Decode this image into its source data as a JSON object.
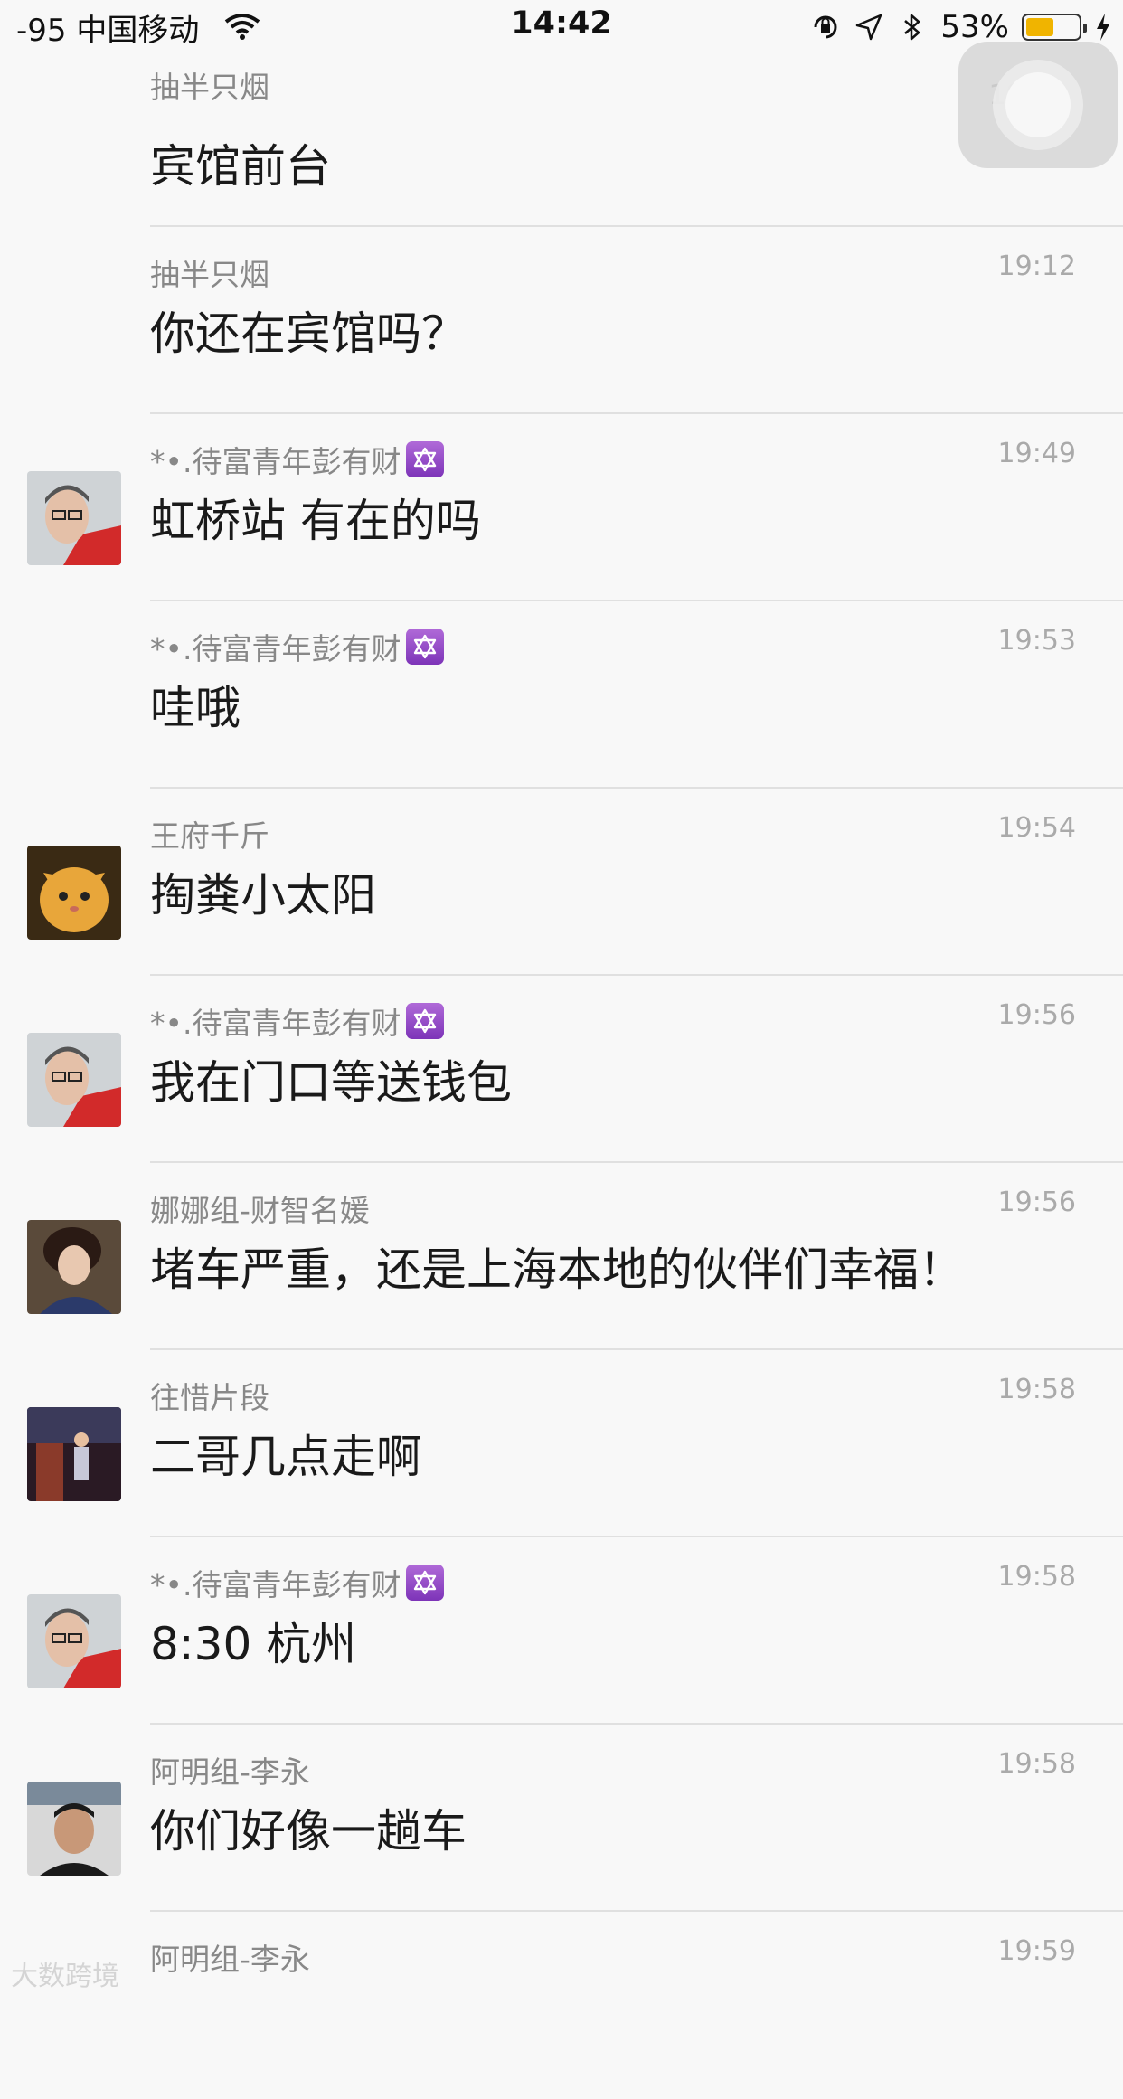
{
  "status_bar": {
    "signal": "-95 中国移动",
    "time": "14:42",
    "battery_percent": "53%",
    "battery_level": 0.53,
    "battery_color": "#f0b400",
    "icons": [
      "wifi-icon",
      "orientation-lock-icon",
      "location-arrow-icon",
      "bluetooth-icon",
      "charging-bolt-icon"
    ]
  },
  "messages": [
    {
      "name": "抽半只烟",
      "time": "19:11",
      "text": "宾馆前台",
      "avatar": "none",
      "badge": false
    },
    {
      "name": "抽半只烟",
      "time": "19:12",
      "text": "你还在宾馆吗？",
      "avatar": "none",
      "badge": false
    },
    {
      "name": "*•.待富青年彭有财",
      "time": "19:49",
      "text": "虹桥站 有在的吗",
      "avatar": "man-glasses-red",
      "badge": true
    },
    {
      "name": "*•.待富青年彭有财",
      "time": "19:53",
      "text": "哇哦",
      "avatar": "none",
      "badge": true
    },
    {
      "name": "王府千斤",
      "time": "19:54",
      "text": "掏粪小太阳",
      "avatar": "orange-kitten",
      "badge": false
    },
    {
      "name": "*•.待富青年彭有财",
      "time": "19:56",
      "text": "我在门口等送钱包",
      "avatar": "man-glasses-red",
      "badge": true
    },
    {
      "name": "娜娜组-财智名媛",
      "time": "19:56",
      "text": "堵车严重，还是上海本地的伙伴们幸福！",
      "avatar": "woman-portrait",
      "badge": false
    },
    {
      "name": "往惜片段",
      "time": "19:58",
      "text": "二哥几点走啊",
      "avatar": "dark-stage-photo",
      "badge": false
    },
    {
      "name": "*•.待富青年彭有财",
      "time": "19:58",
      "text": "8:30 杭州",
      "avatar": "man-glasses-red",
      "badge": true
    },
    {
      "name": "阿明组-李永",
      "time": "19:58",
      "text": "你们好像一趟车",
      "avatar": "man-office",
      "badge": false
    },
    {
      "name": "阿明组-李永",
      "time": "19:59",
      "text": "",
      "avatar": "none",
      "badge": false
    }
  ],
  "watermark": "大数跨境"
}
